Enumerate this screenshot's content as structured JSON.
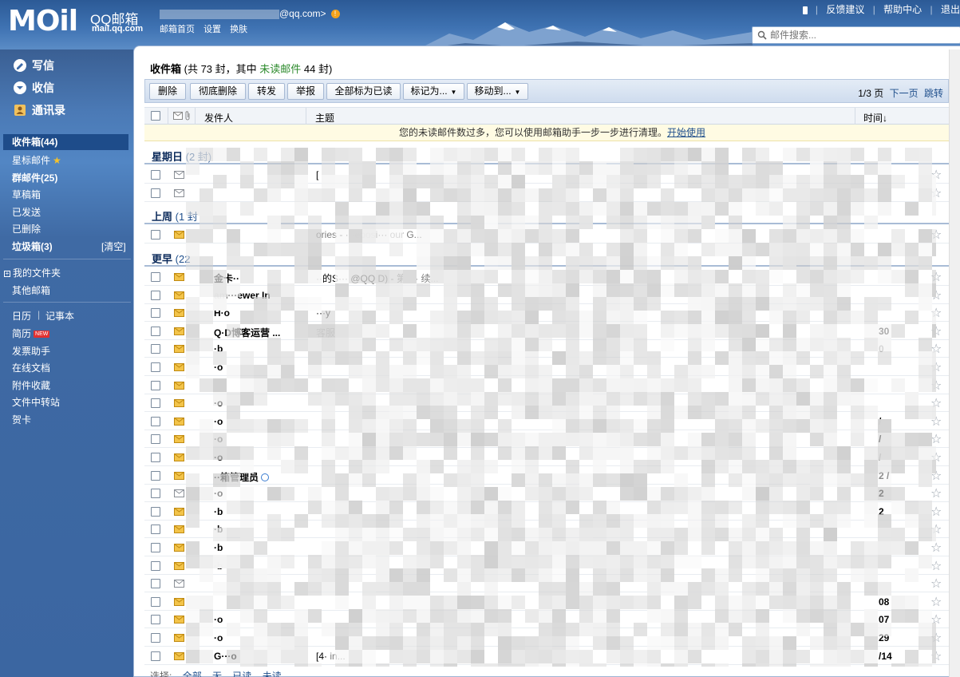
{
  "header": {
    "logo": "MOil",
    "brand": "QQ邮箱",
    "brand_url": "mail.qq.com",
    "account_suffix": "@qq.com>",
    "warning": "!",
    "nav": [
      "邮箱首页",
      "设置",
      "换肤"
    ],
    "top_links": [
      "反馈建议",
      "帮助中心",
      "退出"
    ],
    "search_placeholder": "邮件搜索..."
  },
  "sidebar": {
    "compose": "写信",
    "receive": "收信",
    "contacts": "通讯录",
    "folders": [
      {
        "label": "收件箱(44)",
        "bold": true,
        "active": true
      },
      {
        "label": "星标邮件",
        "star": "★"
      },
      {
        "label": "群邮件(25)",
        "bold": true
      },
      {
        "label": "草稿箱"
      },
      {
        "label": "已发送"
      },
      {
        "label": "已删除"
      },
      {
        "label": "垃圾箱(3)",
        "bold": true,
        "extra": "[清空]"
      }
    ],
    "my_folders": "我的文件夹",
    "other_mailboxes": "其他邮箱",
    "calendar": "日历",
    "notes": "记事本",
    "resume": "简历",
    "new_badge": "NEW",
    "tools": [
      "发票助手",
      "在线文档",
      "附件收藏",
      "文件中转站",
      "贺卡"
    ]
  },
  "main": {
    "title": "收件箱",
    "title_detail_pre": " (共 73 封，其中 ",
    "unread_label": "未读邮件",
    "title_detail_post": " 44 封)",
    "toolbar": {
      "delete": "删除",
      "delete_permanent": "彻底删除",
      "forward": "转发",
      "report": "举报",
      "mark_all_read": "全部标为已读",
      "mark_as": "标记为...",
      "move_to": "移动到..."
    },
    "pager": {
      "page": "1/3 页",
      "next": "下一页",
      "jump": "跳转"
    },
    "columns": {
      "sender": "发件人",
      "subject": "主题",
      "time": "时间↓"
    },
    "notice": "您的未读邮件数过多，您可以使用邮箱助手一步一步进行清理。",
    "notice_link": "开始使用",
    "groups": [
      {
        "label": "星期日",
        "count": "(2 封)"
      },
      {
        "label": "上周",
        "count": "(1 封"
      },
      {
        "label": "更早",
        "count": "(22"
      }
    ],
    "rows": [
      {
        "sender": "",
        "subject": "[",
        "time": "",
        "read": true
      },
      {
        "sender": "",
        "subject": "",
        "time": "",
        "read": true
      },
      {
        "sender": "",
        "subject": "",
        "preview": "ories - ···eposi··· our G...",
        "time": "",
        "read": false
      },
      {
        "sender": "金卡··",
        "subject": "··的S··· @QQ",
        "preview": "D) - 第 ··· 续...",
        "time": "",
        "read": false
      },
      {
        "sender": "am···ewer In",
        "subject": "",
        "time": "",
        "read": false
      },
      {
        "sender": "H·o",
        "subject": "···y",
        "time": "",
        "read": false
      },
      {
        "sender": "Q·D博客运营 ...",
        "subject": "",
        "preview": "客服",
        "time": "30",
        "read": false
      },
      {
        "sender": "·b",
        "subject": "",
        "time": "0",
        "read": false
      },
      {
        "sender": "·o",
        "subject": "",
        "time": "",
        "read": false
      },
      {
        "sender": "",
        "subject": "",
        "time": "",
        "read": false
      },
      {
        "sender": "·o",
        "subject": "",
        "time": "",
        "read": false
      },
      {
        "sender": "·o",
        "subject": "",
        "time": "/",
        "read": false
      },
      {
        "sender": "·o",
        "subject": "",
        "time": "/",
        "read": false
      },
      {
        "sender": "·o",
        "subject": "",
        "time": "/",
        "read": false
      },
      {
        "sender": "··箱管理员",
        "subject": "",
        "time": "2 /",
        "read": false,
        "verified": true
      },
      {
        "sender": "·o",
        "subject": "",
        "time": "2",
        "read": true
      },
      {
        "sender": "·b",
        "subject": "",
        "time": "2",
        "read": false
      },
      {
        "sender": "·b",
        "subject": "",
        "time": "",
        "read": false
      },
      {
        "sender": "·b",
        "subject": "",
        "time": "",
        "read": false
      },
      {
        "sender": "·b",
        "subject": "",
        "time": "",
        "read": false
      },
      {
        "sender": "",
        "subject": "",
        "time": "",
        "read": true
      },
      {
        "sender": "",
        "subject": "",
        "time": "08",
        "read": false
      },
      {
        "sender": "·o",
        "subject": "",
        "time": "07",
        "read": false
      },
      {
        "sender": "·o",
        "subject": "",
        "time": "29",
        "read": false
      },
      {
        "sender": "G···o",
        "subject": "[4·",
        "preview": "in...",
        "time": "/14",
        "read": false
      }
    ],
    "footer": {
      "label": "选择:",
      "options": [
        "全部",
        "无",
        "已读",
        "未读"
      ]
    }
  }
}
